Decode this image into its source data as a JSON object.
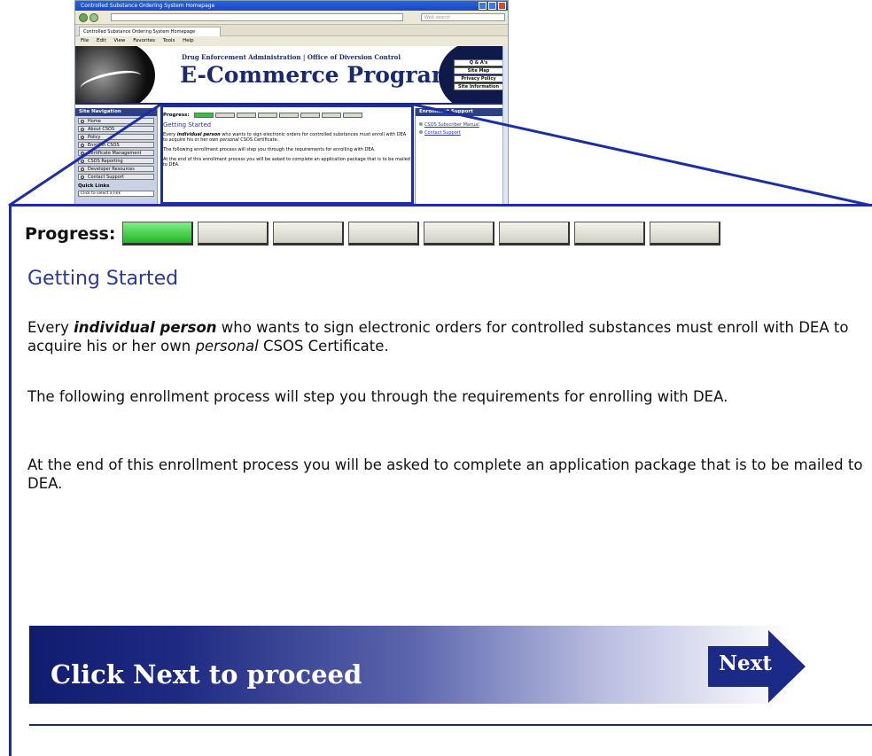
{
  "browser": {
    "window_title": "Controlled Substance Ordering System Homepage",
    "tab_title": "Controlled Substance Ordering System Homepage",
    "search_placeholder": "Web search",
    "menu": [
      "File",
      "Edit",
      "View",
      "Favorites",
      "Tools",
      "Help"
    ]
  },
  "site_header": {
    "subtitle": "Drug Enforcement Administration | Office of Diversion Control",
    "title": "E-Commerce Program",
    "links": [
      "Q & A's",
      "Site Map",
      "Privacy Policy",
      "Site Information"
    ]
  },
  "site_nav": {
    "title": "Site Navigation",
    "items": [
      "Home",
      "About CSOS",
      "Policy",
      "Enroll in CSOS",
      "Certificate Management",
      "CSOS Reporting",
      "Developer Resources",
      "Contact Support"
    ],
    "quick_links_title": "Quick Links",
    "quick_links_select": "Click to select a link"
  },
  "right_panel": {
    "title": "Enrollment Support",
    "links": [
      "CSOS Subscriber Manual",
      "Contact Support"
    ]
  },
  "progress": {
    "label": "Progress:",
    "total_steps": 8,
    "completed_steps": 1
  },
  "content": {
    "title": "Getting Started",
    "para1": {
      "t1": "Every ",
      "t2": "individual person",
      "t3": " who wants to sign electronic orders for controlled substances must enroll with DEA to acquire his or her own ",
      "t4": "personal",
      "t5": " CSOS Certificate."
    },
    "para2": "The following enrollment process will step you through the requirements for enrolling with DEA.",
    "para3": "At the end of this enrollment process you will be asked to complete an application package that is to be mailed to DEA."
  },
  "banner": {
    "text": "Click Next to proceed",
    "next_label": "Next"
  },
  "colors": {
    "frame_blue": "#1b2ea8",
    "title_blue": "#2a379b",
    "done_green": "#22b52a",
    "banner_dark": "#101c6e"
  }
}
